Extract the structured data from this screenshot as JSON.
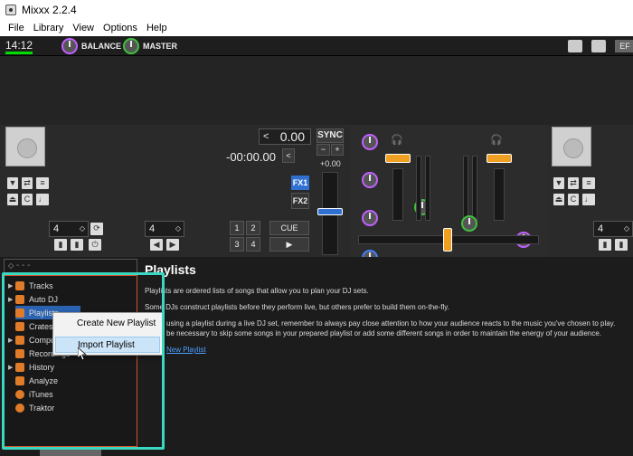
{
  "window": {
    "title": "Mixxx 2.2.4"
  },
  "menu": [
    "File",
    "Library",
    "View",
    "Options",
    "Help"
  ],
  "topbar": {
    "clock": "14:12",
    "balance_label": "BALANCE",
    "master_label": "MASTER",
    "right_btn": "EF"
  },
  "deck1": {
    "time_elapsed": "0.00",
    "time_remaining": "-00:00.00",
    "sync_label": "SYNC",
    "pitch_minus": "−",
    "pitch_plus": "+",
    "rate": "+0.00",
    "fx1": "FX1",
    "fx2": "FX2",
    "beatjump_size": "4",
    "loop_size": "4",
    "hotcues": [
      "1",
      "2",
      "3",
      "4"
    ],
    "cue_label": "CUE",
    "play_label": "▶"
  },
  "deck2": {
    "beatjump_size": "4"
  },
  "library": {
    "search_placeholder": "- - -",
    "sidebar": [
      {
        "label": "Tracks",
        "icon": "music-note-icon",
        "arrow": "▶"
      },
      {
        "label": "Auto DJ",
        "icon": "robot-icon",
        "arrow": "▶"
      },
      {
        "label": "Playlists",
        "icon": "playlist-icon",
        "arrow": ""
      },
      {
        "label": "Crates",
        "icon": "crate-icon",
        "arrow": ""
      },
      {
        "label": "Computer",
        "icon": "computer-icon",
        "arrow": "▶"
      },
      {
        "label": "Recordings",
        "icon": "recording-icon",
        "arrow": ""
      },
      {
        "label": "History",
        "icon": "history-icon",
        "arrow": "▶"
      },
      {
        "label": "Analyze",
        "icon": "analyze-icon",
        "arrow": ""
      },
      {
        "label": "iTunes",
        "icon": "itunes-icon",
        "arrow": ""
      },
      {
        "label": "Traktor",
        "icon": "traktor-icon",
        "arrow": ""
      }
    ],
    "content": {
      "title": "Playlists",
      "p1": "Playlists are ordered lists of songs that allow you to plan your DJ sets.",
      "p2": "Some DJs construct playlists before they perform live, but others prefer to build them on-the-fly.",
      "p3a": "using a playlist during a live DJ set, remember to always pay close attention to how your audience reacts to the music you've chosen to play.",
      "p3b": "be necessary to skip some songs in your prepared playlist or add some different songs in order to maintain the energy of your audience.",
      "link": "New Playlist"
    }
  },
  "context_menu": {
    "items": [
      "Create New Playlist",
      "Import Playlist"
    ],
    "highlighted": "Import Playlist"
  },
  "colors": {
    "accent_teal": "#3ad8c2",
    "fader_orange": "#f0a020",
    "fx_blue": "#3070d0",
    "sidebar_border": "#d0552a"
  }
}
